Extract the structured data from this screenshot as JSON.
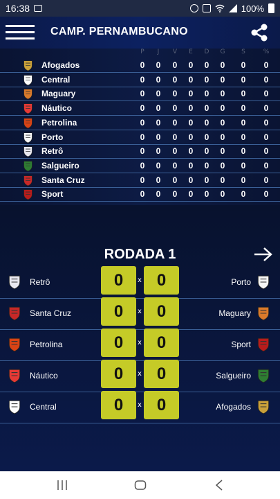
{
  "status_bar": {
    "time": "16:38",
    "battery": "100%"
  },
  "header": {
    "title": "CAMP. PERNAMBUCANO"
  },
  "standings": {
    "columns": [
      "P",
      "J",
      "V",
      "E",
      "D",
      "G",
      "S",
      "%"
    ],
    "teams": [
      {
        "name": "Afogados",
        "badge": "afogados-badge",
        "color": "#c9a03a",
        "stats": [
          "0",
          "0",
          "0",
          "0",
          "0",
          "0",
          "0",
          "0"
        ]
      },
      {
        "name": "Central",
        "badge": "central-badge",
        "color": "#ffffff",
        "stats": [
          "0",
          "0",
          "0",
          "0",
          "0",
          "0",
          "0",
          "0"
        ]
      },
      {
        "name": "Maguary",
        "badge": "maguary-badge",
        "color": "#d97a2b",
        "stats": [
          "0",
          "0",
          "0",
          "0",
          "0",
          "0",
          "0",
          "0"
        ]
      },
      {
        "name": "Náutico",
        "badge": "nautico-badge",
        "color": "#e53935",
        "stats": [
          "0",
          "0",
          "0",
          "0",
          "0",
          "0",
          "0",
          "0"
        ]
      },
      {
        "name": "Petrolina",
        "badge": "petrolina-badge",
        "color": "#d84315",
        "stats": [
          "0",
          "0",
          "0",
          "0",
          "0",
          "0",
          "0",
          "0"
        ]
      },
      {
        "name": "Porto",
        "badge": "porto-badge",
        "color": "#f5f5f5",
        "stats": [
          "0",
          "0",
          "0",
          "0",
          "0",
          "0",
          "0",
          "0"
        ]
      },
      {
        "name": "Retrô",
        "badge": "retro-badge",
        "color": "#e8e8f0",
        "stats": [
          "0",
          "0",
          "0",
          "0",
          "0",
          "0",
          "0",
          "0"
        ]
      },
      {
        "name": "Salgueiro",
        "badge": "salgueiro-badge",
        "color": "#2e7d32",
        "stats": [
          "0",
          "0",
          "0",
          "0",
          "0",
          "0",
          "0",
          "0"
        ]
      },
      {
        "name": "Santa Cruz",
        "badge": "santa-cruz-badge",
        "color": "#c62828",
        "stats": [
          "0",
          "0",
          "0",
          "0",
          "0",
          "0",
          "0",
          "0"
        ]
      },
      {
        "name": "Sport",
        "badge": "sport-badge",
        "color": "#b71c1c",
        "stats": [
          "0",
          "0",
          "0",
          "0",
          "0",
          "0",
          "0",
          "0"
        ]
      }
    ]
  },
  "round": {
    "title": "RODADA 1",
    "separator": "x",
    "matches": [
      {
        "home": "Retrô",
        "away": "Porto",
        "home_score": "0",
        "away_score": "0"
      },
      {
        "home": "Santa Cruz",
        "away": "Maguary",
        "home_score": "0",
        "away_score": "0"
      },
      {
        "home": "Petrolina",
        "away": "Sport",
        "home_score": "0",
        "away_score": "0"
      },
      {
        "home": "Náutico",
        "away": "Salgueiro",
        "home_score": "0",
        "away_score": "0"
      },
      {
        "home": "Central",
        "away": "Afogados",
        "home_score": "0",
        "away_score": "0"
      }
    ]
  },
  "colors": {
    "score_box": "#c5cb27",
    "row_divider": "#3a5f96",
    "background": "#08122e"
  }
}
